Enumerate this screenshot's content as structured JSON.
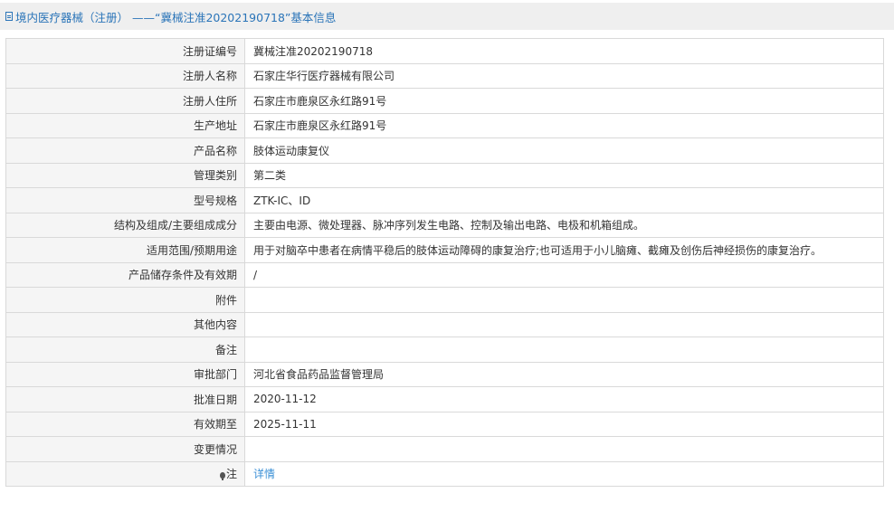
{
  "header": {
    "icon": "document-icon",
    "title": "境内医疗器械（注册） ——“冀械注准20202190718”基本信息"
  },
  "rows": [
    {
      "label": "注册证编号",
      "value": "冀械注准20202190718"
    },
    {
      "label": "注册人名称",
      "value": "石家庄华行医疗器械有限公司"
    },
    {
      "label": "注册人住所",
      "value": "石家庄市鹿泉区永红路91号"
    },
    {
      "label": "生产地址",
      "value": "石家庄市鹿泉区永红路91号"
    },
    {
      "label": "产品名称",
      "value": "肢体运动康复仪"
    },
    {
      "label": "管理类别",
      "value": "第二类"
    },
    {
      "label": "型号规格",
      "value": "ZTK-IC、ID"
    },
    {
      "label": "结构及组成/主要组成成分",
      "value": "主要由电源、微处理器、脉冲序列发生电路、控制及输出电路、电极和机箱组成。"
    },
    {
      "label": "适用范围/预期用途",
      "value": "用于对脑卒中患者在病情平稳后的肢体运动障碍的康复治疗;也可适用于小儿脑瘫、截瘫及创伤后神经损伤的康复治疗。"
    },
    {
      "label": "产品储存条件及有效期",
      "value": "/"
    },
    {
      "label": "附件",
      "value": ""
    },
    {
      "label": "其他内容",
      "value": ""
    },
    {
      "label": "备注",
      "value": ""
    },
    {
      "label": "审批部门",
      "value": "河北省食品药品监督管理局"
    },
    {
      "label": "批准日期",
      "value": "2020-11-12"
    },
    {
      "label": "有效期至",
      "value": "2025-11-11"
    },
    {
      "label": "变更情况",
      "value": ""
    }
  ],
  "note": {
    "icon": "lightbulb-icon",
    "label": "注",
    "link": "详情"
  }
}
